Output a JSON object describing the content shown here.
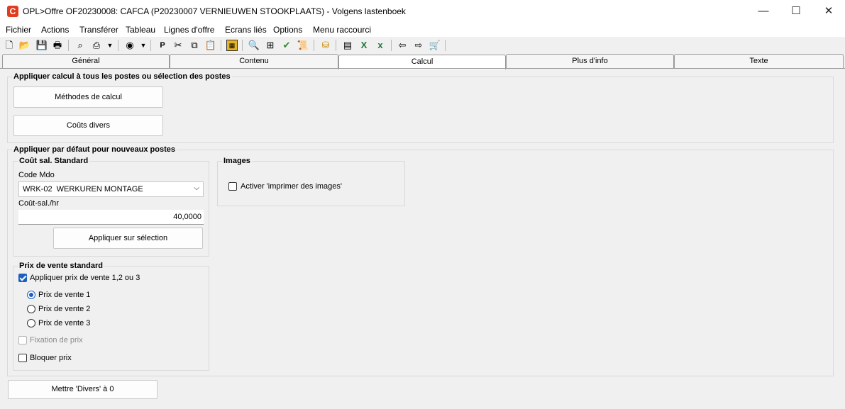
{
  "window": {
    "title": "OPL>Offre OF20230008: CAFCA (P20230007 VERNIEUWEN STOOKPLAATS) - Volgens lastenboek",
    "app_icon": "C",
    "minimize": "—",
    "maximize": "☐",
    "close": "✕"
  },
  "menu": [
    "Fichier",
    "Actions",
    "Transférer",
    "Tableau",
    "Lignes d'offre",
    "Ecrans liés",
    "Options",
    "Menu raccourci"
  ],
  "toolbar_icons": [
    "new-doc-icon",
    "open-folder-icon",
    "save-icon",
    "print-preview-icon",
    "binoculars-icon",
    "printer-icon",
    "dropdown-arrow-icon",
    "globe-icon",
    "dropdown-arrow-icon",
    "p-icon",
    "cut-icon",
    "copy-icon",
    "paste-icon",
    "calculator-icon",
    "magnifier-icon",
    "tree-icon",
    "check-doc-icon",
    "scroll-icon",
    "bucket-icon",
    "stack-icon",
    "excel-icon",
    "excel-x-icon",
    "arrow-left-icon",
    "arrow-right-icon",
    "cart-icon"
  ],
  "tabs": [
    {
      "label": "Général",
      "active": false
    },
    {
      "label": "Contenu",
      "active": false
    },
    {
      "label": "Calcul",
      "active": true
    },
    {
      "label": "Plus d'info",
      "active": false
    },
    {
      "label": "Texte",
      "active": false
    }
  ],
  "section_all": {
    "title": "Appliquer calcul à tous les postes ou sélection des postes",
    "btn_methods": "Méthodes de calcul",
    "btn_costs": "Coûts divers"
  },
  "section_default": {
    "title": "Appliquer par défaut pour nouveaux postes",
    "labor": {
      "title": "Coût sal. Standard",
      "code_label": "Code Mdo",
      "code_value": "WRK-02  WERKUREN MONTAGE",
      "rate_label": "Coût-sal./hr",
      "rate_value": "40,0000",
      "apply_btn": "Appliquer sur sélection"
    },
    "images": {
      "title": "Images",
      "checkbox_label": "Activer 'imprimer des images'",
      "checked": false
    },
    "price": {
      "title": "Prix de vente standard",
      "apply_label": "Appliquer prix de vente 1,2 ou 3",
      "apply_checked": true,
      "options": [
        "Prix de vente 1",
        "Prix de vente 2",
        "Prix de vente 3"
      ],
      "selected": 0,
      "fix_label": "Fixation de prix",
      "block_label": "Bloquer prix"
    }
  },
  "reset_button": "Mettre 'Divers' à 0",
  "colors": {
    "accent": "#1d5fbf",
    "app_icon": "#e03c1f"
  }
}
